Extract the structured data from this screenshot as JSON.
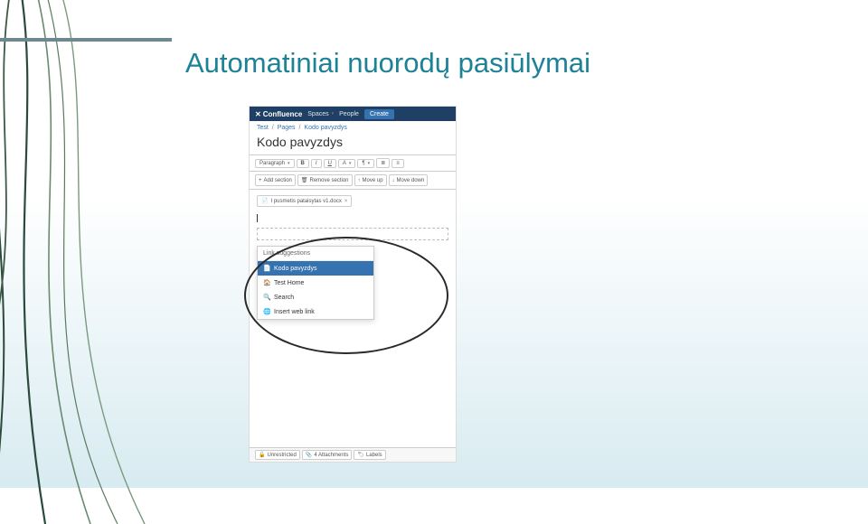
{
  "slide": {
    "title": "Automatiniai nuorodų pasiūlymai"
  },
  "shot": {
    "topbar": {
      "product": "Confluence",
      "nav1": "Spaces",
      "nav2": "People",
      "create": "Create"
    },
    "breadcrumb": {
      "a": "Test",
      "b": "Pages",
      "c": "Kodo pavyzdys"
    },
    "page_title": "Kodo pavyzdys",
    "fmt": {
      "paragraph": "Paragraph",
      "bold": "B",
      "italic": "I",
      "underline": "U",
      "acolor": "A",
      "more": "¶"
    },
    "sect": {
      "add": "Add section",
      "remove": "Remove section",
      "up": "Move up",
      "down": "Move down"
    },
    "filechip": "I pusmetis pataisytas v1.docx",
    "popup": {
      "header": "Link suggestions",
      "i1": "Kodo pavyzdys",
      "i2": "Test Home",
      "i3": "Search",
      "i4": "Insert web link"
    },
    "footer": {
      "restrict": "Unrestricted",
      "attach": "4 Attachments",
      "labels": "Labels"
    }
  }
}
